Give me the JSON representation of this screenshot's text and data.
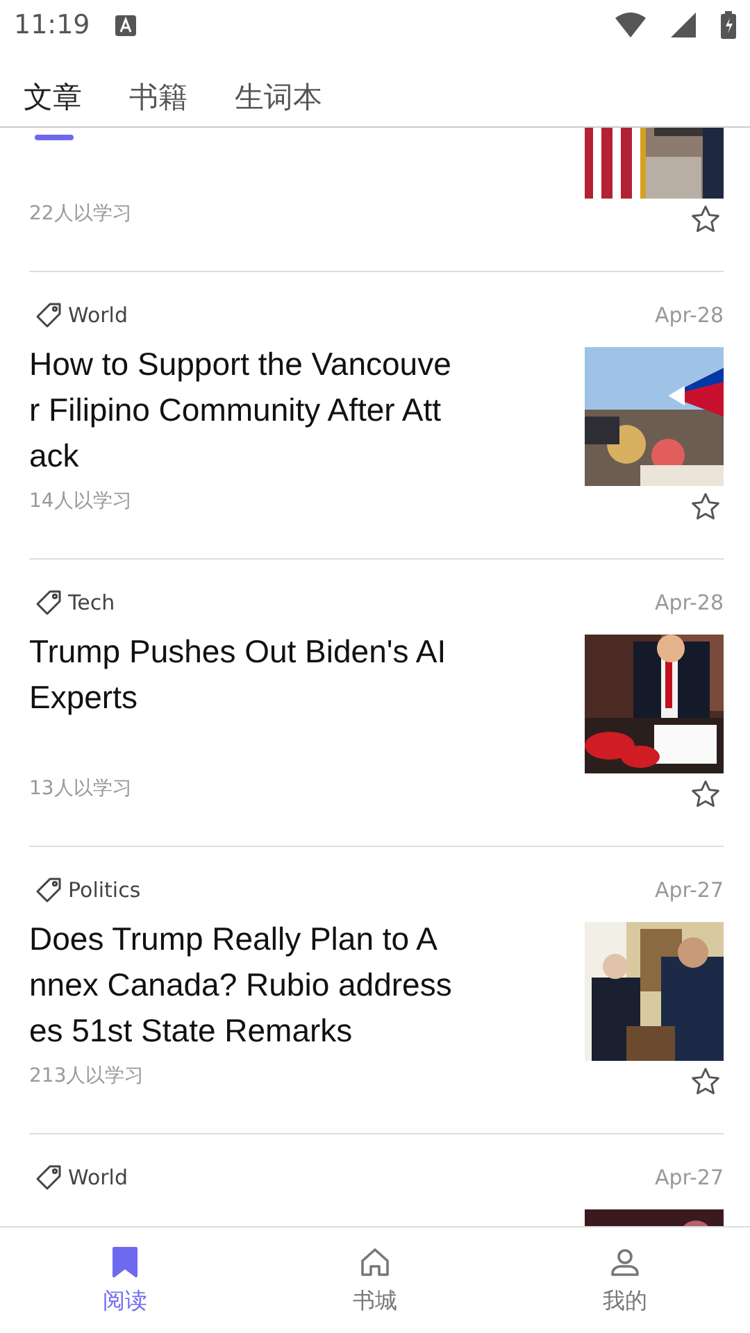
{
  "status_bar": {
    "time": "11:19"
  },
  "tabs": [
    {
      "label": "文章",
      "selected": true
    },
    {
      "label": "书籍",
      "selected": false
    },
    {
      "label": "生词本",
      "selected": false
    }
  ],
  "articles": [
    {
      "learners": "22人以学习",
      "starred": false
    },
    {
      "tag": "World",
      "date": "Apr-28",
      "title": "How to Support the Vancouver Filipino Community After Attack",
      "learners": "14人以学习",
      "starred": false
    },
    {
      "tag": "Tech",
      "date": "Apr-28",
      "title": "Trump Pushes Out Biden's AI Experts",
      "learners": "13人以学习",
      "starred": false
    },
    {
      "tag": "Politics",
      "date": "Apr-27",
      "title": "Does Trump Really Plan to Annex Canada? Rubio addresses 51st State Remarks",
      "learners": "213人以学习",
      "starred": false
    },
    {
      "tag": "World",
      "date": "Apr-27"
    }
  ],
  "bottom_nav": [
    {
      "label": "阅读",
      "selected": true
    },
    {
      "label": "书城",
      "selected": false
    },
    {
      "label": "我的",
      "selected": false
    }
  ]
}
